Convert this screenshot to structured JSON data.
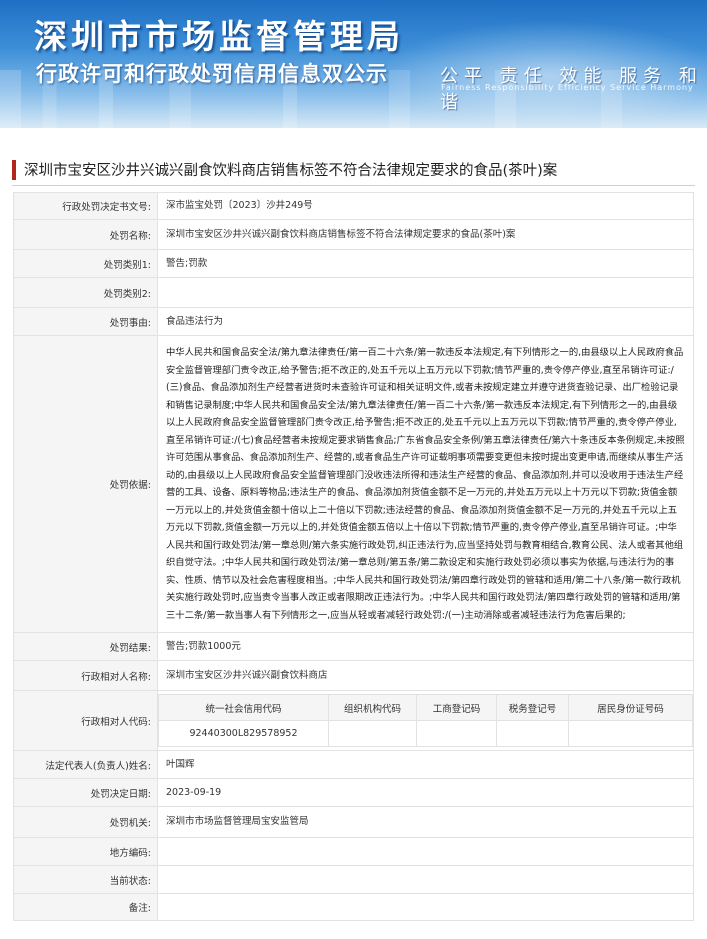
{
  "banner": {
    "title": "深圳市市场监督管理局",
    "subtitle": "行政许可和行政处罚信用信息双公示",
    "slogan": "公平  责任  效能  服务  和谐",
    "slogan_en": "Fairness  Responsibility  Efficiency  Service  Harmony"
  },
  "case_title": "深圳市宝安区沙井兴诚兴副食饮料商店销售标签不符合法律规定要求的食品(茶叶)案",
  "fields": {
    "decision_no": {
      "label": "行政处罚决定书文号:",
      "value": "深市监宝处罚〔2023〕沙井249号"
    },
    "case_name": {
      "label": "处罚名称:",
      "value": "深圳市宝安区沙井兴诚兴副食饮料商店销售标签不符合法律规定要求的食品(茶叶)案"
    },
    "category1": {
      "label": "处罚类别1:",
      "value": "警告;罚款"
    },
    "category2": {
      "label": "处罚类别2:",
      "value": ""
    },
    "reason": {
      "label": "处罚事由:",
      "value": "食品违法行为"
    },
    "basis": {
      "label": "处罚依据:",
      "value": "中华人民共和国食品安全法/第九章法律责任/第一百二十六条/第一款违反本法规定,有下列情形之一的,由县级以上人民政府食品安全监督管理部门责令改正,给予警告;拒不改正的,处五千元以上五万元以下罚款;情节严重的,责令停产停业,直至吊销许可证:/(三)食品、食品添加剂生产经营者进货时未查验许可证和相关证明文件,或者未按规定建立并遵守进货查验记录、出厂检验记录和销售记录制度;中华人民共和国食品安全法/第九章法律责任/第一百二十六条/第一款违反本法规定,有下列情形之一的,由县级以上人民政府食品安全监督管理部门责令改正,给予警告;拒不改正的,处五千元以上五万元以下罚款;情节严重的,责令停产停业,直至吊销许可证:/(七)食品经营者未按规定要求销售食品;广东省食品安全条例/第五章法律责任/第六十条违反本条例规定,未按照许可范围从事食品、食品添加剂生产、经营的,或者食品生产许可证载明事项需要变更但未按时提出变更申请,而继续从事生产活动的,由县级以上人民政府食品安全监督管理部门没收违法所得和违法生产经营的食品、食品添加剂,并可以没收用于违法生产经营的工具、设备、原料等物品;违法生产的食品、食品添加剂货值金额不足一万元的,并处五万元以上十万元以下罚款;货值金额一万元以上的,并处货值金额十倍以上二十倍以下罚款;违法经营的食品、食品添加剂货值金额不足一万元的,并处五千元以上五万元以下罚款,货值金额一万元以上的,并处货值金额五倍以上十倍以下罚款;情节严重的,责令停产停业,直至吊销许可证。;中华人民共和国行政处罚法/第一章总则/第六条实施行政处罚,纠正违法行为,应当坚持处罚与教育相结合,教育公民、法人或者其他组织自觉守法。;中华人民共和国行政处罚法/第一章总则/第五条/第二款设定和实施行政处罚必须以事实为依据,与违法行为的事实、性质、情节以及社会危害程度相当。;中华人民共和国行政处罚法/第四章行政处罚的管辖和适用/第二十八条/第一款行政机关实施行政处罚时,应当责令当事人改正或者限期改正违法行为。;中华人民共和国行政处罚法/第四章行政处罚的管辖和适用/第三十二条/第一款当事人有下列情形之一,应当从轻或者减轻行政处罚:/(一)主动消除或者减轻违法行为危害后果的;"
    },
    "result": {
      "label": "处罚结果:",
      "value": "警告;罚款1000元"
    },
    "party_name": {
      "label": "行政相对人名称:",
      "value": "深圳市宝安区沙井兴诚兴副食饮料商店"
    },
    "party_code": {
      "label": "行政相对人代码:"
    },
    "legal_rep": {
      "label": "法定代表人(负责人)姓名:",
      "value": "叶国辉"
    },
    "decision_date": {
      "label": "处罚决定日期:",
      "value": "2023-09-19"
    },
    "authority": {
      "label": "处罚机关:",
      "value": "深圳市市场监督管理局宝安监管局"
    },
    "area_code": {
      "label": "地方编码:",
      "value": ""
    },
    "status": {
      "label": "当前状态:",
      "value": ""
    },
    "remark": {
      "label": "备注:",
      "value": ""
    }
  },
  "codes": {
    "headers": [
      "统一社会信用代码",
      "组织机构代码",
      "工商登记码",
      "税务登记号",
      "居民身份证号码"
    ],
    "values": [
      "92440300L829578952",
      "",
      "",
      "",
      ""
    ]
  },
  "colors": {
    "accent_bar": "#b3261e",
    "label_bg": "#f5f5f5",
    "border": "#e2e2e2",
    "banner_blue": "#1f6fc4"
  }
}
